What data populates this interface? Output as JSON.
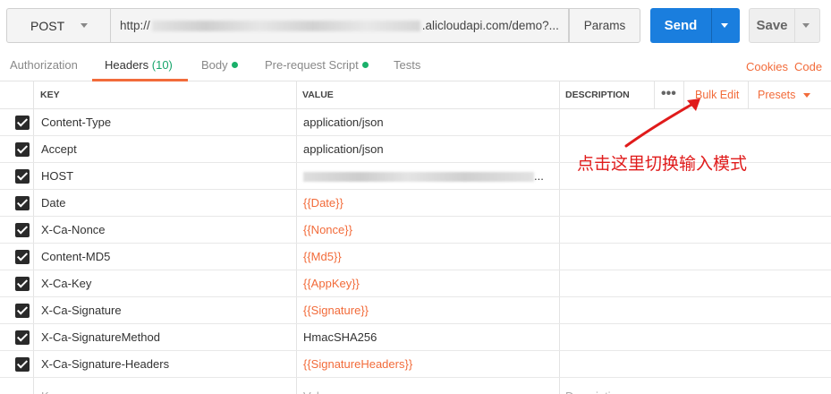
{
  "request": {
    "method": "POST",
    "url_prefix": "http://",
    "url_suffix": ".alicloudapi.com/demo?...",
    "params_label": "Params",
    "send_label": "Send",
    "save_label": "Save"
  },
  "tabs": [
    {
      "label": "Authorization"
    },
    {
      "label": "Headers",
      "count": "(10)"
    },
    {
      "label": "Body"
    },
    {
      "label": "Pre-request Script"
    },
    {
      "label": "Tests"
    }
  ],
  "links": {
    "cookies": "Cookies",
    "code": "Code"
  },
  "table": {
    "headers": {
      "key": "KEY",
      "value": "VALUE",
      "description": "DESCRIPTION"
    },
    "bulk_edit": "Bulk Edit",
    "presets": "Presets",
    "more": "•••",
    "rows": [
      {
        "key": "Content-Type",
        "value": "application/json"
      },
      {
        "key": "Accept",
        "value": "application/json"
      },
      {
        "key": "HOST",
        "value": "...",
        "blurred": true
      },
      {
        "key": "Date",
        "value": "{{Date}}",
        "variable": true
      },
      {
        "key": "X-Ca-Nonce",
        "value": "{{Nonce}}",
        "variable": true
      },
      {
        "key": "Content-MD5",
        "value": "{{Md5}}",
        "variable": true
      },
      {
        "key": "X-Ca-Key",
        "value": "{{AppKey}}",
        "variable": true
      },
      {
        "key": "X-Ca-Signature",
        "value": "{{Signature}}",
        "variable": true
      },
      {
        "key": "X-Ca-SignatureMethod",
        "value": "HmacSHA256"
      },
      {
        "key": "X-Ca-Signature-Headers",
        "value": "{{SignatureHeaders}}",
        "variable": true
      }
    ],
    "placeholders": {
      "key": "Key",
      "value": "Value",
      "description": "Description"
    }
  },
  "annotation": {
    "text": "点击这里切换输入模式",
    "color": "#e01b1b"
  },
  "colors": {
    "accent": "#f26b3a",
    "send": "#1a7ede",
    "dot": "#1ab06a"
  }
}
